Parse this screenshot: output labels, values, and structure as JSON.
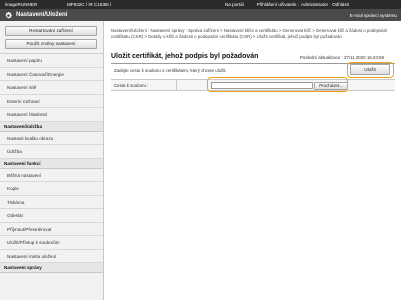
{
  "topbar": {
    "brand": "imageRUNNER",
    "model": "MF832C / iR C1538i /",
    "portal_link": "Na portál",
    "user_label": "Přihlášení uživatele :",
    "user_name": "Administrator",
    "logout_link": "Odhlásit"
  },
  "titlebar": {
    "gear_icon": "gear-icon",
    "title": "Nastavení/Uložení",
    "admin_mail": "E-mail správci systému"
  },
  "sidebar": {
    "restart_button": "Restartování zařízení",
    "apply_button": "Použít změny nastavení",
    "items": [
      {
        "type": "item",
        "label": "Nastavení papíru"
      },
      {
        "type": "item",
        "label": "Nastavení Časovač/Energie"
      },
      {
        "type": "item",
        "label": "Nastavení sítě"
      },
      {
        "type": "item",
        "label": "Externí rozhraní"
      },
      {
        "type": "item",
        "label": "Nastavení hlasitosti"
      },
      {
        "type": "header",
        "label": "Nastavení/údržba"
      },
      {
        "type": "item",
        "label": "Nastavit kvalitu obrazu"
      },
      {
        "type": "item",
        "label": "Údržba"
      },
      {
        "type": "header",
        "label": "Nastavení funkcí"
      },
      {
        "type": "item",
        "label": "Běžná nastavení"
      },
      {
        "type": "item",
        "label": "Kopie"
      },
      {
        "type": "item",
        "label": "Tiskárna"
      },
      {
        "type": "item",
        "label": "Odeslat"
      },
      {
        "type": "item",
        "label": "Příjmout/Přesměrovat"
      },
      {
        "type": "item",
        "label": "Uložit/Přístup k souborům"
      },
      {
        "type": "item",
        "label": "Nastavení místa uložení"
      },
      {
        "type": "header",
        "label": "Nastavení správy"
      }
    ]
  },
  "main": {
    "breadcrumb": "Nastavení/Uložení : Nastavení správy : Správa zařízení > Nastavení klíče a certifikátu > Generovat klíč > Generovat klíč a žádost o podepsání certifikátu (CSR) > Detaily o klíči a žádosti o podepsání certifikátu (CSR) > Uložit certifikát, jehož podpis byl požadován",
    "title": "Uložit certifikát, jehož podpis byl požadován",
    "updated_label": "Poslední aktualizace :",
    "updated_value": "27/11 2020 16:43:58",
    "ok_button": "Uložit",
    "instruction": "Zadejte cestu k souboru s certifikátem, který chcete uložit.",
    "file_label": "Cesta k souboru :",
    "file_value": "",
    "browse_button": "Procházet..."
  }
}
